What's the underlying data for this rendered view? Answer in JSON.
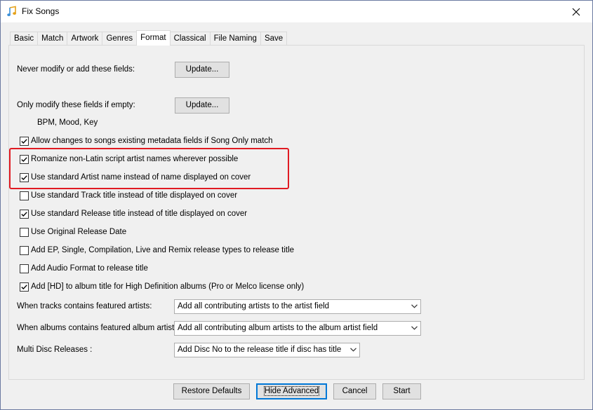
{
  "window": {
    "title": "Fix Songs",
    "icon": "music-note-icon"
  },
  "tabs": [
    {
      "label": "Basic",
      "active": false
    },
    {
      "label": "Match",
      "active": false
    },
    {
      "label": "Artwork",
      "active": false
    },
    {
      "label": "Genres",
      "active": false
    },
    {
      "label": "Format",
      "active": true
    },
    {
      "label": "Classical",
      "active": false
    },
    {
      "label": "File Naming",
      "active": false
    },
    {
      "label": "Save",
      "active": false
    }
  ],
  "format": {
    "never_modify_label": "Never modify or add these fields:",
    "never_modify_button": "Update...",
    "only_modify_label": "Only modify these fields if empty:",
    "only_modify_button": "Update...",
    "only_modify_fields": "BPM, Mood, Key",
    "checkboxes": [
      {
        "label": "Allow changes to songs existing metadata fields if Song Only match",
        "checked": true
      },
      {
        "label": "Romanize non-Latin script artist names wherever possible",
        "checked": true
      },
      {
        "label": "Use standard Artist name instead of name displayed on cover",
        "checked": true
      },
      {
        "label": "Use standard Track title instead of title displayed on cover",
        "checked": false
      },
      {
        "label": "Use standard Release title instead of title displayed on cover",
        "checked": true
      },
      {
        "label": "Use Original Release Date",
        "checked": false
      },
      {
        "label": "Add EP, Single, Compilation, Live and Remix release types to release title",
        "checked": false
      },
      {
        "label": "Add Audio Format to release title",
        "checked": false
      },
      {
        "label": "Add [HD] to album title for High Definition albums (Pro or Melco license only)",
        "checked": true
      }
    ],
    "dropdowns": [
      {
        "label": "When tracks contains featured artists:",
        "value": "Add all contributing artists to the artist field"
      },
      {
        "label": "When albums contains featured album artists:",
        "value": "Add all contributing album artists to the album artist field"
      },
      {
        "label": "Multi Disc Releases :",
        "value": "Add Disc No to the release title if disc has title"
      }
    ]
  },
  "footer": {
    "restore_defaults": "Restore Defaults",
    "hide_advanced": "Hide Advanced",
    "cancel": "Cancel",
    "start": "Start"
  },
  "colors": {
    "highlight": "#e01a22",
    "accent": "#0078d7",
    "check": "#000000"
  }
}
